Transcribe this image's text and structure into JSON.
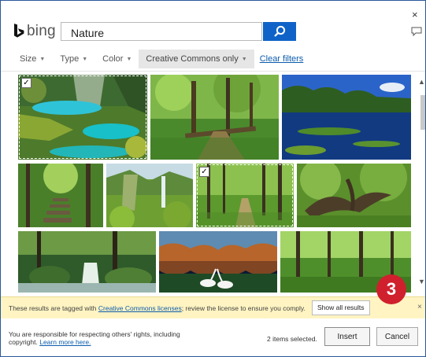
{
  "dialog": {
    "close_glyph": "×",
    "logo_text": "bing"
  },
  "search": {
    "query": "Nature"
  },
  "filters": {
    "size": "Size",
    "type": "Type",
    "color": "Color",
    "license": "Creative Commons only",
    "clear": "Clear filters"
  },
  "results": [
    {
      "name": "turquoise-lakes-waterfalls",
      "checked": true
    },
    {
      "name": "forest-path-fallen-log",
      "checked": false
    },
    {
      "name": "forest-pond-reflection",
      "checked": false
    },
    {
      "name": "forest-stone-steps",
      "checked": false
    },
    {
      "name": "green-canyon-waterfall",
      "checked": false
    },
    {
      "name": "tree-lined-forest-path",
      "checked": true
    },
    {
      "name": "twisted-mossy-tree",
      "checked": false
    },
    {
      "name": "mossy-forest-stream",
      "checked": false
    },
    {
      "name": "autumn-lake-swans",
      "checked": false
    },
    {
      "name": "green-forest-trees",
      "checked": false
    }
  ],
  "notice": {
    "prefix": "These results are tagged with ",
    "link": "Creative Commons licenses",
    "suffix": "; review the license to ensure you comply.",
    "show_all": "Show all results",
    "close_glyph": "×"
  },
  "footer": {
    "legal_line1": "You are responsible for respecting others' rights, including",
    "legal_line2": "copyright. ",
    "learn_more": "Learn more here.",
    "selected_count": "2 items selected.",
    "insert": "Insert",
    "cancel": "Cancel"
  },
  "callout": {
    "number": "3",
    "color": "#d0202e"
  },
  "colors": {
    "accent": "#0f63c8",
    "link": "#0b5cad",
    "notice_bg": "#fff4c2"
  }
}
